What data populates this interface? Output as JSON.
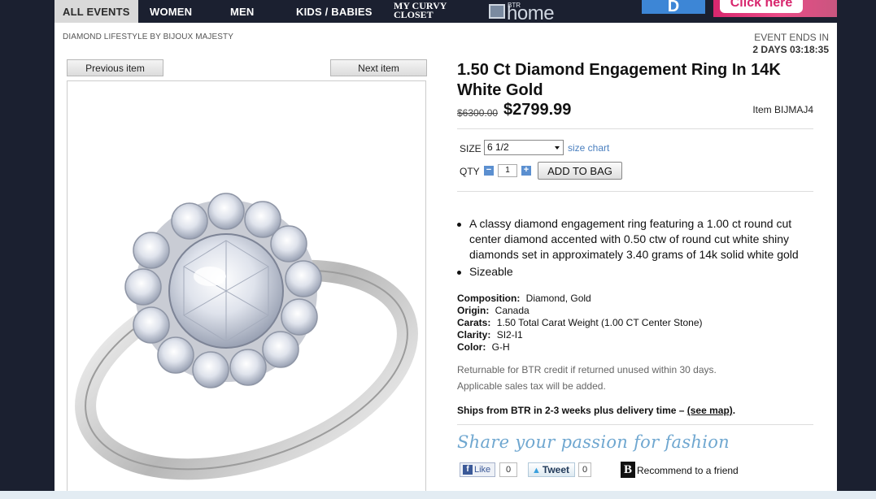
{
  "nav": {
    "items": [
      "ALL EVENTS",
      "WOMEN",
      "MEN",
      "KIDS / BABIES"
    ],
    "curvy_logo": [
      "MY CURVY",
      "CLOSET"
    ],
    "home_logo": {
      "small": "BTR",
      "word": "home"
    },
    "ad_blue_text": "D",
    "ad_pink_text": "Click here"
  },
  "page": {
    "brand_crumb": "DIAMOND LIFESTYLE BY BIJOUX MAJESTY",
    "event_label": "EVENT ENDS IN",
    "event_time": "2 DAYS 03:18:35"
  },
  "pager": {
    "prev": "Previous item",
    "next": "Next item"
  },
  "product": {
    "title": "1.50 Ct Diamond Engagement Ring In 14K White Gold",
    "old_price": "$6300.00",
    "price": "$2799.99",
    "item_code": "Item BIJMAJ4",
    "size_label": "SIZE",
    "size_value": "6 1/2",
    "size_chart": "size chart",
    "qty_label": "QTY",
    "qty_minus": "−",
    "qty_value": "1",
    "qty_plus": "+",
    "add_to_bag": "ADD TO BAG",
    "bullets": [
      "A classy diamond engagement ring featuring a 1.00 ct round cut center diamond accented with 0.50 ctw of round cut white shiny diamonds set in approximately 3.40 grams of 14k solid white gold",
      "Sizeable"
    ],
    "specs": [
      {
        "label": "Composition:",
        "value": "Diamond, Gold"
      },
      {
        "label": "Origin:",
        "value": "Canada"
      },
      {
        "label": "Carats:",
        "value": "1.50 Total Carat Weight (1.00 CT Center Stone)"
      },
      {
        "label": "Clarity:",
        "value": "SI2-I1"
      },
      {
        "label": "Color:",
        "value": "G-H"
      }
    ],
    "return_note": "Returnable for BTR credit if returned unused within 30 days.",
    "tax_note": "Applicable sales tax will be added.",
    "ships_text": "Ships from BTR in 2-3 weeks plus delivery time – ",
    "ships_link": "(see map)",
    "ships_end": "."
  },
  "share": {
    "heading": "Share your passion for fashion",
    "fb_label": "Like",
    "fb_count": "0",
    "tweet_label": "Tweet",
    "tweet_count": "0",
    "recommend": "Recommend to a friend"
  },
  "colors": {
    "nav_bg": "#1b2030",
    "link": "#4a7fbf",
    "share_script": "#6fa7d0"
  }
}
